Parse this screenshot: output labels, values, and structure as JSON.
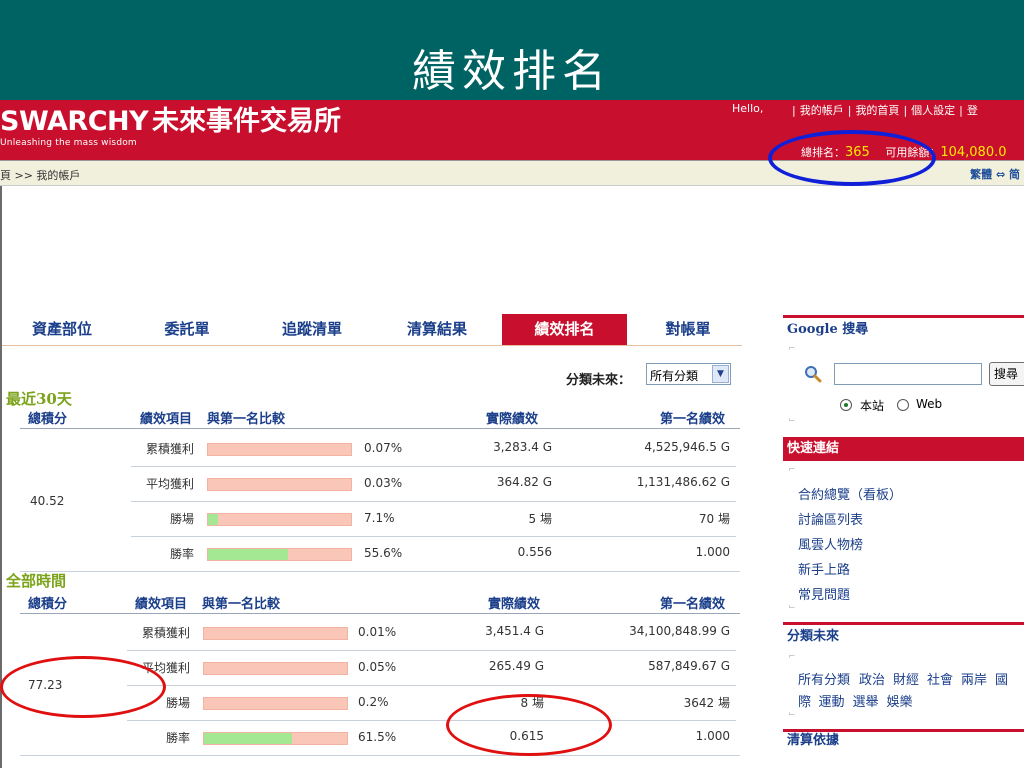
{
  "slide": {
    "title": "績效排名"
  },
  "header": {
    "logo_en": "SWARCHY",
    "logo_zh": "未來事件交易所",
    "tagline": "Unleashing the mass wisdom",
    "hello": "Hello,",
    "links": [
      "|",
      "我的帳戶",
      "|",
      "我的首頁",
      "|",
      "個人設定",
      "|",
      "登"
    ],
    "rank_label": "總排名：",
    "rank_value": "365",
    "funds_label": "可用餘額：",
    "funds_value": "104,080.0"
  },
  "breadcrumb": "頁 >> 我的帳戶",
  "lang_switch": "繁體 ⇔ 简",
  "tabs": [
    "資產部位",
    "委託單",
    "追蹤清單",
    "清算結果",
    "績效排名",
    "對帳單"
  ],
  "active_tab": "績效排名",
  "filter": {
    "label": "分類未來：",
    "value": "所有分類"
  },
  "recent": {
    "title": "最近30天",
    "headers": {
      "total": "總積分",
      "item": "績效項目",
      "compare": "與第一名比較",
      "actual": "實際績效",
      "first": "第一名績效"
    },
    "score": "40.52",
    "rows": [
      {
        "label": "累積獲利",
        "fill": 0.0007,
        "pct": "0.07%",
        "actual": "3,283.4 G",
        "first": "4,525,946.5 G"
      },
      {
        "label": "平均獲利",
        "fill": 0.0003,
        "pct": "0.03%",
        "actual": "364.82 G",
        "first": "1,131,486.62 G"
      },
      {
        "label": "勝場",
        "fill": 0.071,
        "pct": "7.1%",
        "actual": "5 場",
        "first": "70 場"
      },
      {
        "label": "勝率",
        "fill": 0.556,
        "pct": "55.6%",
        "actual": "0.556",
        "first": "1.000"
      }
    ]
  },
  "alltime": {
    "title": "全部時間",
    "headers": {
      "total": "總積分",
      "item": "績效項目",
      "compare": "與第一名比較",
      "actual": "實際績效",
      "first": "第一名績效"
    },
    "score": "77.23",
    "rows": [
      {
        "label": "累積獲利",
        "fill": 0.0001,
        "pct": "0.01%",
        "actual": "3,451.4 G",
        "first": "34,100,848.99 G"
      },
      {
        "label": "平均獲利",
        "fill": 0.0005,
        "pct": "0.05%",
        "actual": "265.49 G",
        "first": "587,849.67 G"
      },
      {
        "label": "勝場",
        "fill": 0.002,
        "pct": "0.2%",
        "actual": "8 場",
        "first": "3642 場"
      },
      {
        "label": "勝率",
        "fill": 0.615,
        "pct": "61.5%",
        "actual": "0.615",
        "first": "1.000"
      }
    ]
  },
  "sidebar": {
    "google_title": "Google 搜尋",
    "search_button": "搜尋",
    "radio_site": "本站",
    "radio_web": "Web",
    "quick_title": "快速連結",
    "quick_links": [
      "合約總覽（看板）",
      "討論區列表",
      "風雲人物榜",
      "新手上路",
      "常見問題"
    ],
    "cat_title": "分類未來",
    "categories_line1": [
      "所有分類",
      "政治",
      "財經",
      "社會",
      "兩岸",
      "國"
    ],
    "categories_line2": [
      "際",
      "運動",
      "選舉",
      "娛樂"
    ],
    "clear_title": "清算依據"
  },
  "colors": {
    "slide_bg": "#006363",
    "brand_red": "#c8102e",
    "link_blue": "#1b3f8a",
    "bar_bg": "#f9c6b8",
    "bar_fill": "#a4e894",
    "section_green": "#7ba31a"
  }
}
